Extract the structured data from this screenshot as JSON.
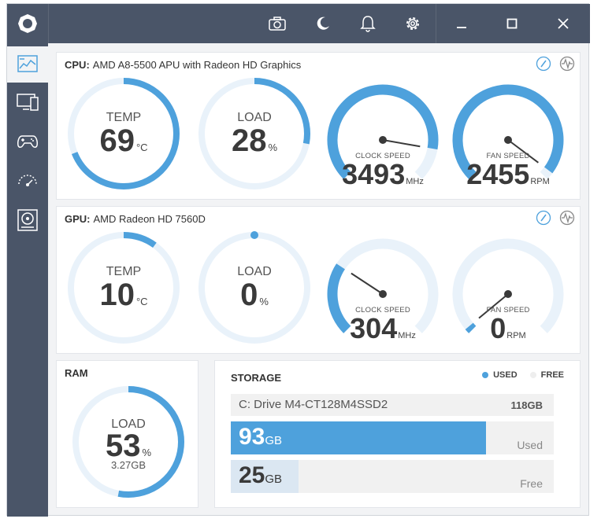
{
  "colors": {
    "accent": "#4ea1dc",
    "track": "#e9f2fa",
    "frame": "#4a5568",
    "free_fill": "#dbe7f2"
  },
  "titlebar": {
    "logo_icon": "app-logo-icon",
    "icons": [
      "camera-icon",
      "moon-icon",
      "bell-icon",
      "gear-icon"
    ],
    "window_controls": [
      "minimize-icon",
      "maximize-icon",
      "close-icon"
    ]
  },
  "sidebar": {
    "items": [
      {
        "icon": "dashboard-icon",
        "active": true
      },
      {
        "icon": "monitor-icon",
        "active": false
      },
      {
        "icon": "gamepad-icon",
        "active": false
      },
      {
        "icon": "speedometer-icon",
        "active": false
      },
      {
        "icon": "storage-icon",
        "active": false
      }
    ]
  },
  "cpu": {
    "label": "CPU:",
    "model": "AMD A8-5500 APU with Radeon HD Graphics",
    "temp": {
      "label": "TEMP",
      "value": "69",
      "unit": "°C",
      "level": 0.69
    },
    "load": {
      "label": "LOAD",
      "value": "28",
      "unit": "%",
      "level": 0.28
    },
    "clock": {
      "label": "CLOCK SPEED",
      "value": "3493",
      "unit": "MHz",
      "level": 0.87
    },
    "fan": {
      "label": "FAN SPEED",
      "value": "2455",
      "unit": "RPM",
      "level": 0.97
    }
  },
  "gpu": {
    "label": "GPU:",
    "model": "AMD Radeon HD 7560D",
    "temp": {
      "label": "TEMP",
      "value": "10",
      "unit": "°C",
      "level": 0.1
    },
    "load": {
      "label": "LOAD",
      "value": "0",
      "unit": "%",
      "level": 0
    },
    "clock": {
      "label": "CLOCK SPEED",
      "value": "304",
      "unit": "MHz",
      "level": 0.29
    },
    "fan": {
      "label": "FAN SPEED",
      "value": "0",
      "unit": "RPM",
      "level": 0.02
    }
  },
  "ram": {
    "label": "RAM",
    "load": {
      "label": "LOAD",
      "value": "53",
      "unit": "%",
      "sub": "3.27GB",
      "level": 0.53
    }
  },
  "storage": {
    "label": "STORAGE",
    "legend": {
      "used": "USED",
      "free": "FREE"
    },
    "drive": {
      "name": "C: Drive M4-CT128M4SSD2",
      "total": "118GB"
    },
    "used": {
      "value": "93",
      "unit": "GB",
      "tag": "Used",
      "fraction": 0.79
    },
    "free": {
      "value": "25",
      "unit": "GB",
      "tag": "Free",
      "fraction": 0.21
    }
  }
}
